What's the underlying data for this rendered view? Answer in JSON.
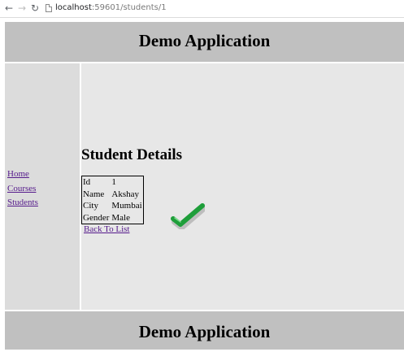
{
  "browser": {
    "url_host": "localhost",
    "url_path": ":59601/students/1"
  },
  "header": {
    "title": "Demo Application"
  },
  "sidebar": {
    "links": [
      {
        "label": "Home"
      },
      {
        "label": "Courses"
      },
      {
        "label": "Students"
      }
    ]
  },
  "main": {
    "heading": "Student Details",
    "details": [
      {
        "field": "Id",
        "value": "1"
      },
      {
        "field": "Name",
        "value": "Akshay"
      },
      {
        "field": "City",
        "value": "Mumbai"
      },
      {
        "field": "Gender",
        "value": "Male"
      }
    ],
    "back_link": "Back To List",
    "checkmark_icon": "checkmark-icon",
    "checkmark_color": "#1e9e3a"
  },
  "footer": {
    "title": "Demo Application"
  },
  "colors": {
    "header_bg": "#c0c0c0",
    "sidebar_bg": "#dcdcdc",
    "main_bg": "#e7e7e7",
    "link": "#551a8b"
  }
}
